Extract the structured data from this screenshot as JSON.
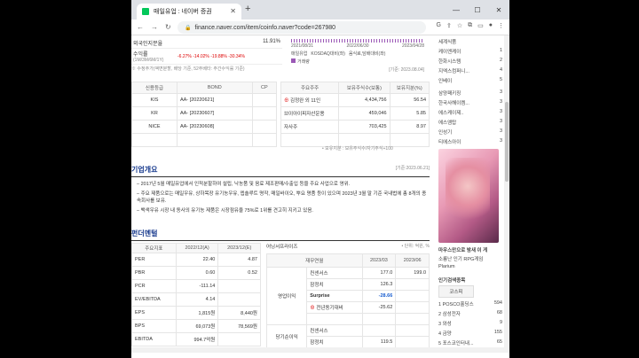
{
  "browser": {
    "tab_title": "매일유업 : 네이버 증권",
    "url": "finance.naver.com/item/coinfo.naver?code=267980",
    "close_glyph": "✕",
    "newtab_glyph": "+",
    "minimize_glyph": "—",
    "maximize_glyph": "☐",
    "winclose_glyph": "✕"
  },
  "top": {
    "row1_label": "외국인지분율",
    "row1_value": "11.91%",
    "row2_label": "수익률",
    "row2_sub": "(1M/3M/6M/1Y)",
    "row2_values": [
      "-6.27%",
      "-14.02%",
      "-19.88%",
      "-30.34%"
    ],
    "note": "※ 수정주가(액면분할, 배당 기준, 52주베타: 주간수익률 기준)",
    "chart_dates": [
      "2021/08/31",
      "2022/06/30",
      "2023/04/28"
    ],
    "legend": [
      "매일유업",
      "KOSDAQ대비(좌)",
      "음식료,담배대비(좌)",
      "거래량"
    ],
    "date": "[기준: 2023.08.04]"
  },
  "credit": {
    "headers": [
      "신용등급",
      "BOND",
      "CP"
    ],
    "rows": [
      {
        "agency": "KIS",
        "bond": "AA-",
        "bond_date": "[20220621]",
        "cp": ""
      },
      {
        "agency": "KR",
        "bond": "AA-",
        "bond_date": "[20230607]",
        "cp": ""
      },
      {
        "agency": "NICE",
        "bond": "AA-",
        "bond_date": "[20230608]",
        "cp": ""
      }
    ]
  },
  "holders": {
    "headers": [
      "주요주주",
      "보유주식수(보통)",
      "보유지분(%)"
    ],
    "rows": [
      {
        "name": "김정완 외 11인",
        "shares": "4,434,756",
        "pct": "56.54"
      },
      {
        "name": "브이아이피자산운용",
        "shares": "459,046",
        "pct": "5.85"
      },
      {
        "name": "자사주",
        "shares": "703,425",
        "pct": "8.97"
      }
    ],
    "note": "• 보유지분 : 보유주식수/자기주식+100"
  },
  "overview": {
    "title": "기업개요",
    "date": "[기준:2023.06.21]",
    "items": [
      "2017년 5월 매일유업에서 인적분할하여 설립, 낙농품 및 음료 제조판매/수출입 등을 주요 사업으로 영위.",
      "주요 제품으로는 매일우유, 상하목장 유기농우유, 엡솔루트 명작, 매일바이오, 뿌요 명품 등이 있으며 2023년 3월 말 기준 국내법에 총 8개의 종속회사를 보유.",
      "백색우유 시장 내 동사의 유기농 제품은 시장점유율 75%로 1위를 견고히 지키고 있음."
    ]
  },
  "fundamentals": {
    "title": "펀더멘털",
    "unit": "• 단위: 억원, %",
    "left_headers": [
      "주요지표",
      "2022/12(A)",
      "2023/12(E)"
    ],
    "left_rows": [
      {
        "label": "PER",
        "a": "22.40",
        "e": "4.87"
      },
      {
        "label": "PBR",
        "a": "0.60",
        "e": "0.52"
      },
      {
        "label": "PCR",
        "a": "-111.14",
        "e": ""
      },
      {
        "label": "EV/EBITDA",
        "a": "4.14",
        "e": ""
      },
      {
        "label": "EPS",
        "a": "1,815원",
        "e": "8,440원"
      },
      {
        "label": "BPS",
        "a": "69,073원",
        "e": "78,569원"
      },
      {
        "label": "EBITDA",
        "a": "994.7억원",
        "e": ""
      }
    ],
    "right_title": "어닝서프라이즈",
    "right_headers": [
      "재무연월",
      "",
      "2023/03",
      "2023/06"
    ],
    "right_rows": [
      {
        "group": "영업이익",
        "label": "컨센서스",
        "v1": "177.0",
        "v2": "199.0"
      },
      {
        "group": "",
        "label": "잠정치",
        "v1": "126.3",
        "v2": ""
      },
      {
        "group": "",
        "label": "Surprise",
        "v1": "-28.66",
        "v2": ""
      },
      {
        "group": "",
        "label": "전년동기대비",
        "v1": "-25.62",
        "v2": ""
      },
      {
        "group": "",
        "label": "",
        "v1": "",
        "v2": ""
      },
      {
        "group": "당기순이익",
        "label": "컨센서스",
        "v1": "",
        "v2": ""
      },
      {
        "group": "",
        "label": "잠정치",
        "v1": "119.5",
        "v2": ""
      }
    ]
  },
  "sidebar": {
    "list_top": [
      {
        "name": "세계식품",
        "n": ""
      },
      {
        "name": "케이엔케이",
        "n": "1"
      },
      {
        "name": "한화시스템",
        "n": "2"
      },
      {
        "name": "지엑스컴퍼니...",
        "n": "4"
      },
      {
        "name": "인베이",
        "n": "5"
      }
    ],
    "list_mid": [
      {
        "name": "삼양패키징",
        "n": "3"
      },
      {
        "name": "한국사해이켐...",
        "n": "3"
      },
      {
        "name": "에스케이제..",
        "n": "3"
      },
      {
        "name": "에스엠탑",
        "n": "3"
      },
      {
        "name": "인성기",
        "n": "3"
      },
      {
        "name": "티에스아이",
        "n": "3"
      }
    ],
    "ad_title": "마우스만으로 밤새 이 게",
    "ad_sub": "소룡난 인기 RPG게임",
    "ad_brand": "Plarium",
    "popular_title": "인기검색종목",
    "popular_tab": "코스피",
    "popular": [
      {
        "rank": "1",
        "name": "POSCO홀딩스",
        "n": "594"
      },
      {
        "rank": "2",
        "name": "삼성전자",
        "n": "68"
      },
      {
        "rank": "3",
        "name": "와성",
        "n": "9"
      },
      {
        "rank": "4",
        "name": "금양",
        "n": "155"
      },
      {
        "rank": "5",
        "name": "포스코인터내...",
        "n": "65"
      }
    ]
  }
}
